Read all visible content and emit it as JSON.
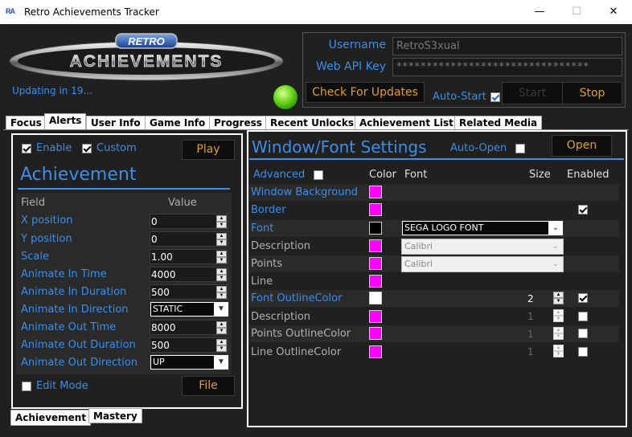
{
  "window": {
    "title": "Retro Achievements Tracker",
    "app_icon_text": "RA",
    "min_glyph": "—",
    "max_glyph": "☐",
    "close_glyph": "✕"
  },
  "logo": {
    "top_text": "RETRO",
    "main_text": "ACHIEVEMENTS"
  },
  "status": {
    "updating_text": "Updating in 19..."
  },
  "account": {
    "username_label": "Username",
    "username_value": "RetroS3xual",
    "webapi_label": "Web API Key",
    "webapi_value": "********************************",
    "check_updates_label": "Check For Updates",
    "autostart_label": "Auto-Start",
    "start_label": "Start",
    "stop_label": "Stop"
  },
  "tabs": [
    "Focus",
    "Alerts",
    "User Info",
    "Game Info",
    "Progress",
    "Recent Unlocks",
    "Achievement List",
    "Related Media"
  ],
  "left": {
    "enable_label": "Enable",
    "custom_label": "Custom",
    "play_label": "Play",
    "section_title": "Achievement",
    "col_field": "Field",
    "col_value": "Value",
    "fields": [
      {
        "label": "X position",
        "value": "0"
      },
      {
        "label": "Y position",
        "value": "0"
      },
      {
        "label": "Scale",
        "value": "1.00"
      },
      {
        "label": "Animate In Time",
        "value": "4000"
      },
      {
        "label": "Animate In Duration",
        "value": "500"
      },
      {
        "label": "Animate In Direction",
        "value": "STATIC"
      },
      {
        "label": "Animate Out Time",
        "value": "8000"
      },
      {
        "label": "Animate Out Duration",
        "value": "500"
      },
      {
        "label": "Animate Out Direction",
        "value": "UP"
      }
    ],
    "edit_mode_label": "Edit Mode",
    "file_label": "File",
    "bottom_tabs": [
      "Achievement",
      "Mastery"
    ]
  },
  "right": {
    "title": "Window/Font Settings",
    "auto_open_label": "Auto-Open",
    "open_label": "Open",
    "advanced_label": "Advanced",
    "col_color": "Color",
    "col_font": "Font",
    "col_size": "Size",
    "col_enabled": "Enabled",
    "rows": [
      {
        "label": "Window Background",
        "color": "#ff00ff",
        "enabled_label": true
      },
      {
        "label": "Border",
        "color": "#ff00ff",
        "enabled_label": true
      },
      {
        "label": "Font",
        "color": "#000000",
        "font": "SEGA LOGO FONT",
        "enabled_label": true
      },
      {
        "label": "Description",
        "color": "#ff00ff",
        "font": "Calibri",
        "enabled_label": false
      },
      {
        "label": "Points",
        "color": "#ff00ff",
        "font": "Calibri",
        "enabled_label": false
      },
      {
        "label": "Line",
        "color": "#ff00ff",
        "enabled_label": false
      },
      {
        "label": "Font OutlineColor",
        "color": "#ffffff",
        "size": "2",
        "enabled_label": true
      },
      {
        "label": "Description",
        "color": "#ff00ff",
        "size": "1",
        "enabled_label": false
      },
      {
        "label": "Points OutlineColor",
        "color": "#ff00ff",
        "size": "1",
        "enabled_label": false
      },
      {
        "label": "Line OutlineColor",
        "color": "#ff00ff",
        "size": "1",
        "enabled_label": false
      }
    ]
  },
  "colors": {
    "accent_blue": "#3b8eea",
    "button_gold": "#e0a020",
    "magenta": "#ff00ff",
    "background": "#202020"
  }
}
